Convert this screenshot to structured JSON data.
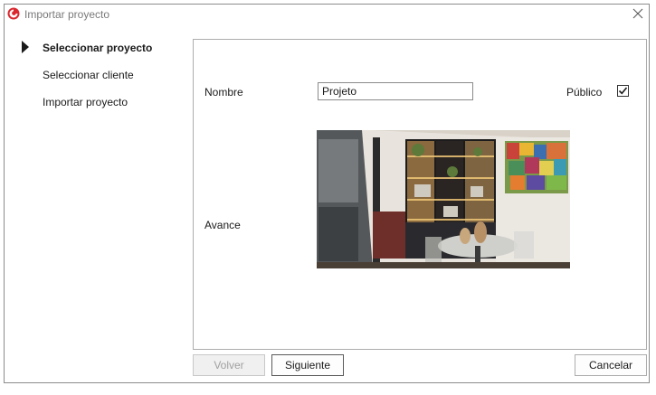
{
  "window": {
    "title": "Importar proyecto"
  },
  "steps": [
    {
      "label": "Seleccionar proyecto",
      "active": true
    },
    {
      "label": "Seleccionar cliente",
      "active": false
    },
    {
      "label": "Importar proyecto",
      "active": false
    }
  ],
  "form": {
    "name_label": "Nombre",
    "name_value": "Projeto",
    "public_label": "Público",
    "public_checked": true,
    "preview_label": "Avance"
  },
  "buttons": {
    "back": "Volver",
    "next": "Siguiente",
    "cancel": "Cancelar"
  }
}
